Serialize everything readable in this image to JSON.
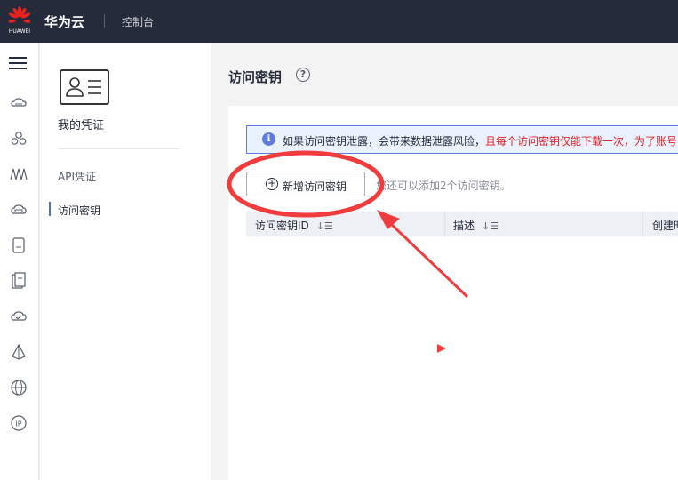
{
  "header": {
    "logo_text": "HUAWEI",
    "brand": "华为云",
    "console": "控制台"
  },
  "rail": {
    "icons": [
      "cloud-server-icon",
      "network-icon",
      "monitor-icon",
      "storage-icon",
      "database-icon",
      "document-icon",
      "cloud-check-icon",
      "deploy-icon",
      "globe-icon",
      "ip-icon"
    ]
  },
  "subnav": {
    "title": "我的凭证",
    "items": [
      {
        "label": "API凭证"
      },
      {
        "label": "访问密钥"
      }
    ]
  },
  "main": {
    "title": "访问密钥",
    "notice_text": "如果访问密钥泄露，会带来数据泄露风险，",
    "notice_warning": "且每个访问密钥仅能下载一次，为了账号",
    "add_button": "新增访问密钥",
    "quota_text": "您还可以添加2个访问密钥。",
    "table": {
      "columns": [
        "访问密钥ID",
        "描述",
        "创建时"
      ]
    }
  },
  "colors": {
    "topbar": "#252b3a",
    "accent": "#5e7ce0",
    "warning": "#e02020",
    "annotation": "#f03c3c"
  }
}
